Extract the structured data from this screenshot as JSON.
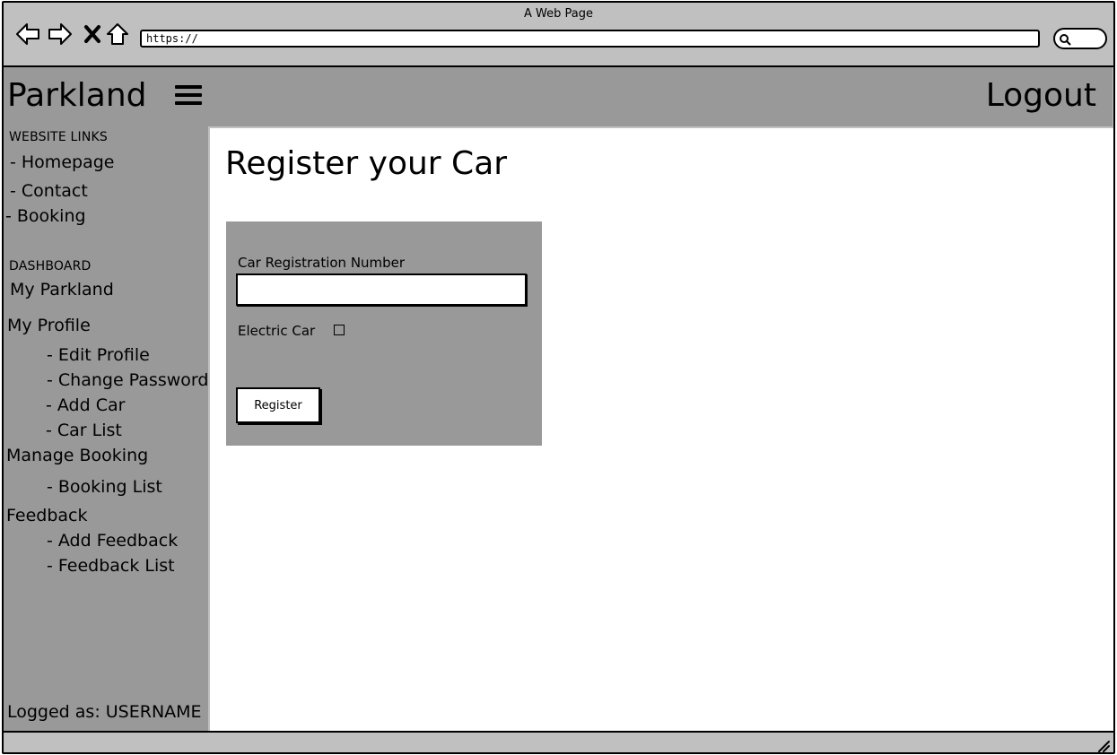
{
  "browser": {
    "window_title": "A Web Page",
    "url": "https://",
    "icons": [
      "back-icon",
      "forward-icon",
      "close-icon",
      "home-icon",
      "search-icon"
    ]
  },
  "header": {
    "brand": "Parkland",
    "menu_icon": "hamburger-menu-icon",
    "logout_label": "Logout"
  },
  "sidebar": {
    "website_links_heading": "WEBSITE LINKS",
    "website_links": [
      "- Homepage",
      "- Contact",
      "- Booking"
    ],
    "dashboard_heading": "DASHBOARD",
    "my_parkland": "My Parkland",
    "my_profile": "My Profile",
    "profile_items": [
      "- Edit Profile",
      "- Change Password",
      "- Add Car",
      "- Car List"
    ],
    "manage_booking": "Manage Booking",
    "booking_items": [
      "- Booking List"
    ],
    "feedback": "Feedback",
    "feedback_items": [
      "- Add Feedback",
      "- Feedback List"
    ],
    "logged_as": "Logged as: USERNAME"
  },
  "main": {
    "title": "Register your Car",
    "form": {
      "reg_label": "Car Registration Number",
      "reg_value": "",
      "electric_label": "Electric Car",
      "electric_checked": false,
      "submit_label": "Register"
    }
  },
  "colors": {
    "chrome": "#c0c0c0",
    "panel": "#999999",
    "content": "#ffffff"
  }
}
